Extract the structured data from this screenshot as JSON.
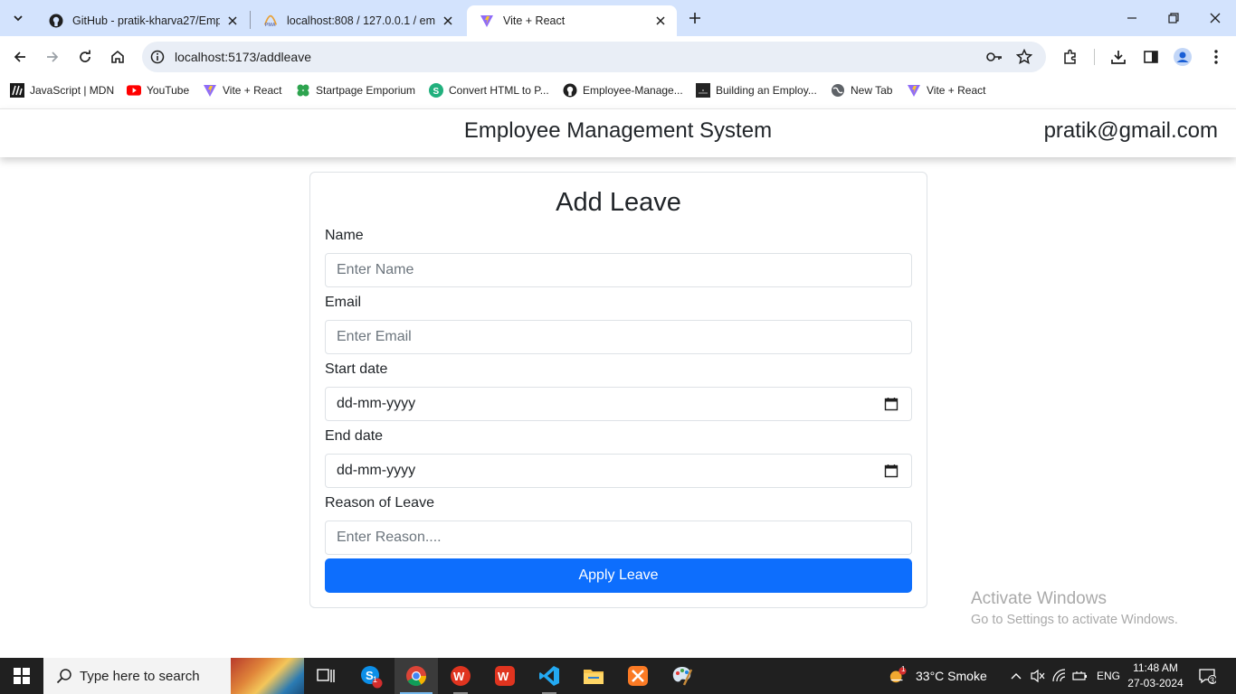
{
  "browser": {
    "tabs": [
      {
        "title": "GitHub - pratik-kharva27/Empl",
        "icon": "github-icon",
        "active": false
      },
      {
        "title": "localhost:808 / 127.0.0.1 / empl",
        "icon": "phpmyadmin-icon",
        "active": false
      },
      {
        "title": "Vite + React",
        "icon": "vite-icon",
        "active": true
      }
    ],
    "url": "localhost:5173/addleave",
    "bookmarks": [
      {
        "label": "JavaScript | MDN",
        "icon": "mdn-icon"
      },
      {
        "label": "YouTube",
        "icon": "youtube-icon"
      },
      {
        "label": "Vite + React",
        "icon": "vite-icon"
      },
      {
        "label": "Startpage Emporium",
        "icon": "clover-icon"
      },
      {
        "label": "Convert HTML to P...",
        "icon": "convert-icon"
      },
      {
        "label": "Employee-Manage...",
        "icon": "github-icon"
      },
      {
        "label": "Building an Employ...",
        "icon": "page-icon"
      },
      {
        "label": "New Tab",
        "icon": "globe-icon"
      },
      {
        "label": "Vite + React",
        "icon": "vite-icon"
      }
    ]
  },
  "app": {
    "title": "Employee Management System",
    "user_email": "pratik@gmail.com"
  },
  "form": {
    "heading": "Add Leave",
    "name_label": "Name",
    "name_placeholder": "Enter Name",
    "email_label": "Email",
    "email_placeholder": "Enter Email",
    "start_label": "Start date",
    "start_value": "dd-mm-yyyy",
    "end_label": "End date",
    "end_value": "dd-mm-yyyy",
    "reason_label": "Reason of Leave",
    "reason_placeholder": "Enter Reason....",
    "submit_label": "Apply Leave",
    "button_color": "#0d6efd"
  },
  "watermark": {
    "line1": "Activate Windows",
    "line2": "Go to Settings to activate Windows."
  },
  "taskbar": {
    "search_placeholder": "Type here to search",
    "weather": "33°C  Smoke",
    "weather_badge": "1",
    "language": "ENG",
    "time": "11:48 AM",
    "date": "27-03-2024",
    "notification_count": "3",
    "skype_badge": "1"
  }
}
